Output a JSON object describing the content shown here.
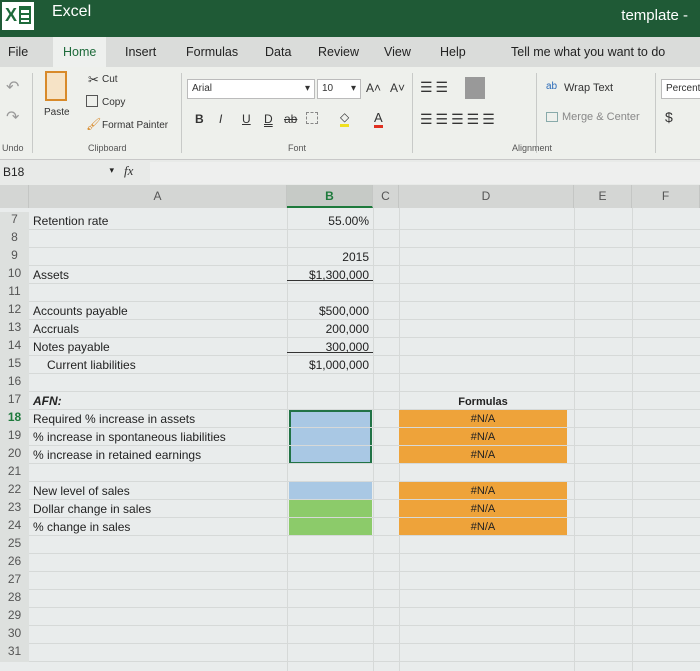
{
  "titlebar": {
    "app": "Excel",
    "document": "template  -"
  },
  "tabs": [
    "File",
    "Home",
    "Insert",
    "Formulas",
    "Data",
    "Review",
    "View",
    "Help",
    "Tell me what you want to do"
  ],
  "ribbon": {
    "undo_label": "Undo",
    "paste": "Paste",
    "cut": "Cut",
    "copy": "Copy",
    "format_painter": "Format Painter",
    "clipboard": "Clipboard",
    "font_name": "Arial",
    "font_size": "10",
    "font_group": "Font",
    "bold": "B",
    "italic": "I",
    "underline": "U",
    "double_underline": "D",
    "strikethrough": "ab",
    "wrap_text": "Wrap Text",
    "merge_center": "Merge & Center",
    "alignment": "Alignment",
    "number_format": "Percenta",
    "currency": "$"
  },
  "formula_bar": {
    "name_box": "B18",
    "fx": "fx",
    "value": ""
  },
  "columns": [
    "A",
    "B",
    "C",
    "D",
    "E",
    "F"
  ],
  "selected_column": "B",
  "rows": [
    {
      "n": "7",
      "a": "Retention rate",
      "b": "55.00%"
    },
    {
      "n": "8",
      "a": "",
      "b": ""
    },
    {
      "n": "9",
      "a": "",
      "b": "2015"
    },
    {
      "n": "10",
      "a": "Assets",
      "b": "$1,300,000"
    },
    {
      "n": "11",
      "a": "",
      "b": ""
    },
    {
      "n": "12",
      "a": "Accounts payable",
      "b": "$500,000"
    },
    {
      "n": "13",
      "a": "Accruals",
      "b": "200,000"
    },
    {
      "n": "14",
      "a": "Notes payable",
      "b": "300,000"
    },
    {
      "n": "15",
      "a": "   Current liabilities",
      "b": "$1,000,000"
    },
    {
      "n": "16",
      "a": "",
      "b": ""
    },
    {
      "n": "17",
      "a": "AFN:",
      "b": ""
    },
    {
      "n": "18",
      "a": "Required % increase in assets",
      "b": ""
    },
    {
      "n": "19",
      "a": "% increase in spontaneous liabilities",
      "b": ""
    },
    {
      "n": "20",
      "a": "% increase in retained earnings",
      "b": ""
    },
    {
      "n": "21",
      "a": "",
      "b": ""
    },
    {
      "n": "22",
      "a": "New level of sales",
      "b": ""
    },
    {
      "n": "23",
      "a": "Dollar change in sales",
      "b": ""
    },
    {
      "n": "24",
      "a": "% change in sales",
      "b": ""
    },
    {
      "n": "25",
      "a": "",
      "b": ""
    },
    {
      "n": "26",
      "a": "",
      "b": ""
    },
    {
      "n": "27",
      "a": "",
      "b": ""
    },
    {
      "n": "28",
      "a": "",
      "b": ""
    },
    {
      "n": "29",
      "a": "",
      "b": ""
    },
    {
      "n": "30",
      "a": "",
      "b": ""
    },
    {
      "n": "31",
      "a": "",
      "b": ""
    }
  ],
  "formulas": {
    "header": "Formulas",
    "values": [
      "#N/A",
      "#N/A",
      "#N/A",
      "#N/A",
      "#N/A",
      "#N/A"
    ]
  },
  "colors": {
    "excel_green": "#1f5a36",
    "input_blue": "#a9c8e4",
    "input_green": "#8ccb6a",
    "formula_orange": "#eea33a"
  }
}
